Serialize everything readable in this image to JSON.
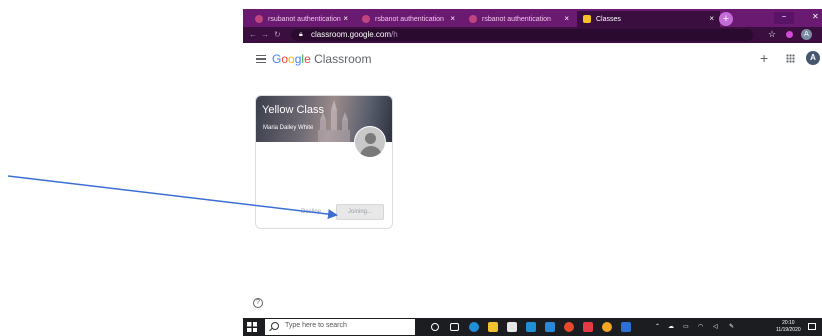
{
  "browser": {
    "tabs": [
      {
        "title": "rsubanot authentication"
      },
      {
        "title": "rsbanot authentication"
      },
      {
        "title": "rsbanot authentication"
      },
      {
        "title": "Classes"
      }
    ],
    "new_tab": "+",
    "window_min": "−",
    "window_close": "✕",
    "url_domain": "classroom.google.com",
    "url_path": "/h",
    "profile_initial": "A"
  },
  "header": {
    "logo_parts": [
      "G",
      "o",
      "o",
      "g",
      "l",
      "e"
    ],
    "product": " Classroom",
    "add_label": "+",
    "avatar_initial": "A"
  },
  "card": {
    "title": "Yellow Class",
    "teacher": "Maria Dailey White",
    "decline_label": "Decline",
    "joining_label": "Joining..."
  },
  "help_label": "?",
  "taskbar": {
    "search_placeholder": "Type here to search",
    "clock_time": "20:10",
    "clock_date": "11/19/2020"
  },
  "colors": {
    "tabstrip": "#6b1a72",
    "active_tab": "#3a0f3f",
    "arrow": "#3b6fd4",
    "taskbar": "#1c1d21"
  }
}
